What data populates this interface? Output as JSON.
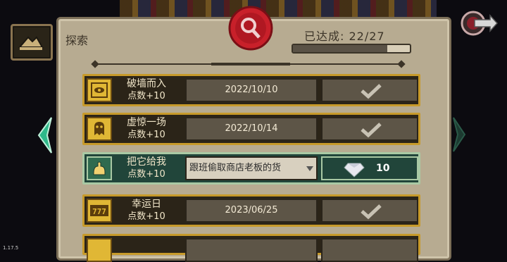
{
  "header": {
    "tab_title": "探索",
    "progress_label": "已达成: 22/27",
    "progress_value": 0.81
  },
  "achievements": [
    {
      "name": "破墙而入",
      "points": "点数+10",
      "date": "2022/10/10",
      "status": "completed",
      "icon": "eye-box-icon"
    },
    {
      "name": "虚惊一场",
      "points": "点数+10",
      "date": "2022/10/14",
      "status": "completed",
      "icon": "ghost-icon"
    },
    {
      "name": "把它给我",
      "points": "点数+10",
      "description": "跟班偷取商店老板的货",
      "status": "pending",
      "reward_value": "10",
      "icon": "grab-hand-icon"
    },
    {
      "name": "幸运日",
      "points": "点数+10",
      "date": "2023/06/25",
      "status": "completed",
      "icon": "slot-777-icon"
    }
  ],
  "version": "1.17.5",
  "colors": {
    "panel": "#b7ab91",
    "gold_border": "#c79a2a",
    "pending_bg": "#21453a",
    "seal_red": "#c8202a"
  }
}
